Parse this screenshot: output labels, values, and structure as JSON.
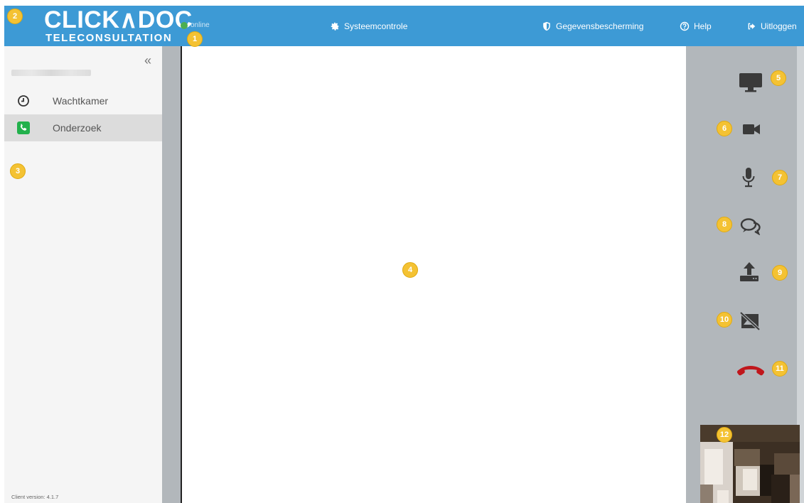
{
  "header": {
    "logo_main": "CLICK∧DOC",
    "logo_sub": "TELECONSULTATION",
    "status": "online",
    "nav": {
      "system_check": "Systeemcontrole",
      "privacy": "Gegevensbescherming",
      "help": "Help",
      "logout": "Uitloggen"
    }
  },
  "sidebar": {
    "collapse_glyph": "«",
    "items": [
      {
        "label": "Wachtkamer",
        "icon": "clock-icon"
      },
      {
        "label": "Onderzoek",
        "icon": "phone-icon",
        "active": true
      }
    ],
    "client_version": "Client version: 4.1.7"
  },
  "controls": {
    "screen_share": "monitor-icon",
    "camera": "video-camera-icon",
    "microphone": "microphone-icon",
    "chat": "chat-icon",
    "upload": "upload-icon",
    "image_off": "image-off-icon",
    "hangup": "hangup-icon"
  },
  "badges": [
    "1",
    "2",
    "3",
    "4",
    "5",
    "6",
    "7",
    "8",
    "9",
    "10",
    "11",
    "12"
  ],
  "colors": {
    "topbar": "#3d9ad5",
    "sidebar": "#f5f5f5",
    "panel": "#b2b7bb",
    "active_phone": "#22b14c",
    "hangup": "#c0171c",
    "badge": "#f4c233"
  }
}
